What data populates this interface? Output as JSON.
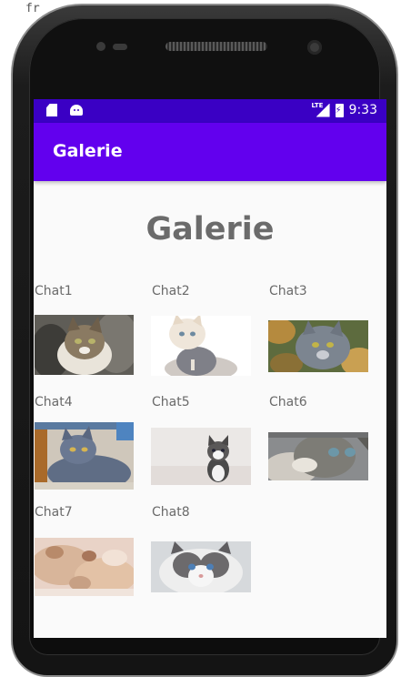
{
  "background_fragment": "fr",
  "status_bar": {
    "lte_label": "LTE",
    "time": "9:33"
  },
  "app_bar": {
    "title": "Galerie"
  },
  "heading": "Galerie",
  "gallery": [
    {
      "label": "Chat1"
    },
    {
      "label": "Chat2"
    },
    {
      "label": "Chat3"
    },
    {
      "label": "Chat4"
    },
    {
      "label": "Chat5"
    },
    {
      "label": "Chat6"
    },
    {
      "label": "Chat7"
    },
    {
      "label": "Chat8"
    }
  ],
  "colors": {
    "status_bar": "#3a00c4",
    "app_bar": "#6200ee",
    "screen_bg": "#fafafa",
    "label_text": "#6a6a6a"
  }
}
